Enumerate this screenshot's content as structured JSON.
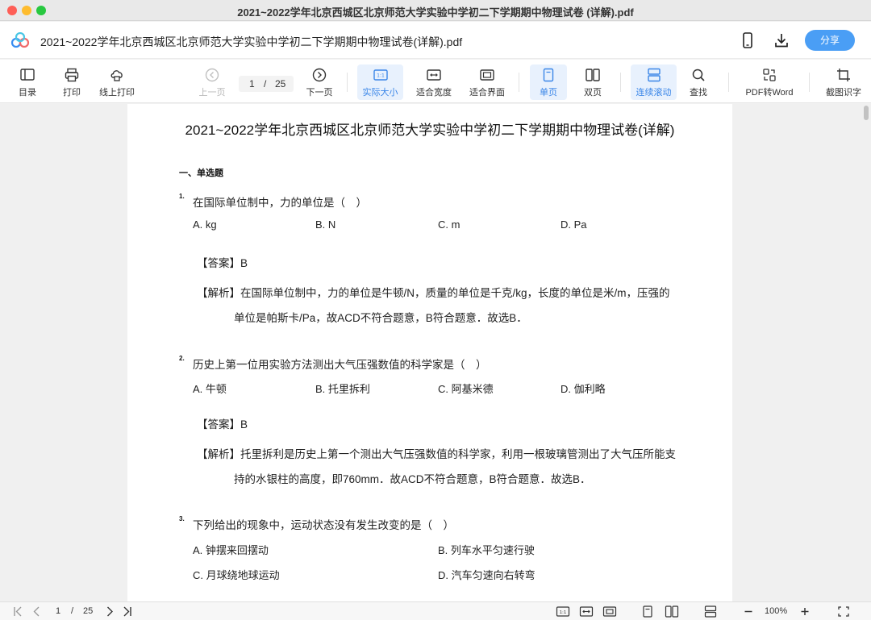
{
  "window": {
    "title": "2021~2022学年北京西城区北京师范大学实验中学初二下学期期中物理试卷 (详解).pdf"
  },
  "appbar": {
    "doc_title": "2021~2022学年北京西城区北京师范大学实验中学初二下学期期中物理试卷(详解).pdf",
    "share_label": "分享"
  },
  "toolbar": {
    "toc": "目录",
    "print": "打印",
    "online_print": "线上打印",
    "prev": "上一页",
    "next": "下一页",
    "current_page": "1",
    "page_sep": "/",
    "total_pages": "25",
    "actual_size": "实际大小",
    "fit_width": "适合宽度",
    "fit_page": "适合界面",
    "single": "单页",
    "double": "双页",
    "continuous": "连续滚动",
    "find": "查找",
    "to_word": "PDF转Word",
    "ocr": "截图识字"
  },
  "document": {
    "title": "2021~2022学年北京西城区北京师范大学实验中学初二下学期期中物理试卷(详解)",
    "section": "一、单选题",
    "questions": [
      {
        "num": "1.",
        "text": "在国际单位制中，力的单位是（　）",
        "options": [
          "A. kg",
          "B. N",
          "C. m",
          "D. Pa"
        ],
        "answer": "【答案】B",
        "analysis_1": "【解析】在国际单位制中，力的单位是牛顿/N，质量的单位是千克/kg，长度的单位是米/m，压强的",
        "analysis_2": "单位是帕斯卡/Pa，故ACD不符合题意，B符合题意．故选B．"
      },
      {
        "num": "2.",
        "text": "历史上第一位用实验方法测出大气压强数值的科学家是（　）",
        "options": [
          "A. 牛顿",
          "B. 托里拆利",
          "C. 阿基米德",
          "D. 伽利略"
        ],
        "answer": "【答案】B",
        "analysis_1": "【解析】托里拆利是历史上第一个测出大气压强数值的科学家，利用一根玻璃管测出了大气压所能支",
        "analysis_2": "持的水银柱的高度，即760mm．故ACD不符合题意，B符合题意．故选B．"
      },
      {
        "num": "3.",
        "text": "下列给出的现象中，运动状态没有发生改变的是（　）",
        "options": [
          "A. 钟摆来回摆动",
          "B. 列车水平匀速行驶",
          "C. 月球绕地球运动",
          "D. 汽车匀速向右转弯"
        ]
      }
    ]
  },
  "bottombar": {
    "current_page": "1",
    "page_sep": "/",
    "total_pages": "25",
    "zoom": "100%"
  }
}
